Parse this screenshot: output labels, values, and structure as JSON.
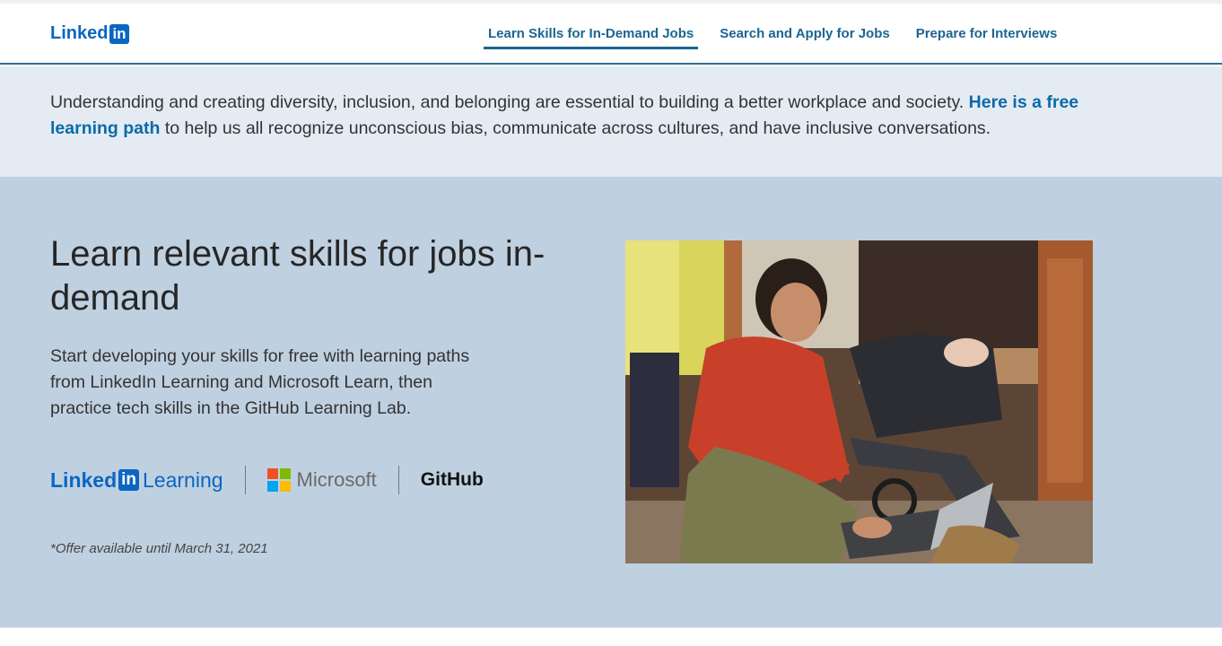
{
  "nav": {
    "logo_text": "Linked",
    "logo_box": "in",
    "tabs": [
      {
        "label": "Learn Skills for In-Demand Jobs",
        "active": true
      },
      {
        "label": "Search and Apply for Jobs",
        "active": false
      },
      {
        "label": "Prepare for Interviews",
        "active": false
      }
    ]
  },
  "notice": {
    "text_before": "Understanding and creating diversity, inclusion, and belonging are essential to building a better workplace and society. ",
    "link_text": "Here is a free learning path",
    "text_after": " to help us all recognize unconscious bias, communicate across cultures, and have inclusive conversations."
  },
  "hero": {
    "title": "Learn relevant skills for jobs in-demand",
    "description": "Start developing your skills for free with learning paths from LinkedIn Learning and Microsoft Learn, then practice tech skills in the GitHub Learning Lab.",
    "partners": {
      "linkedin_text": "Linked",
      "linkedin_box": "in",
      "linkedin_learning": "Learning",
      "microsoft": "Microsoft",
      "github": "GitHub"
    },
    "offer_note": "*Offer available until March 31, 2021"
  },
  "colors": {
    "brand_blue": "#0a66c2",
    "nav_link": "#1b6592",
    "notice_bg": "#e5ebf3",
    "hero_bg": "#bfd0e1",
    "ms_red": "#f25022",
    "ms_green": "#7fba00",
    "ms_blue": "#00a4ef",
    "ms_yellow": "#ffb900"
  }
}
